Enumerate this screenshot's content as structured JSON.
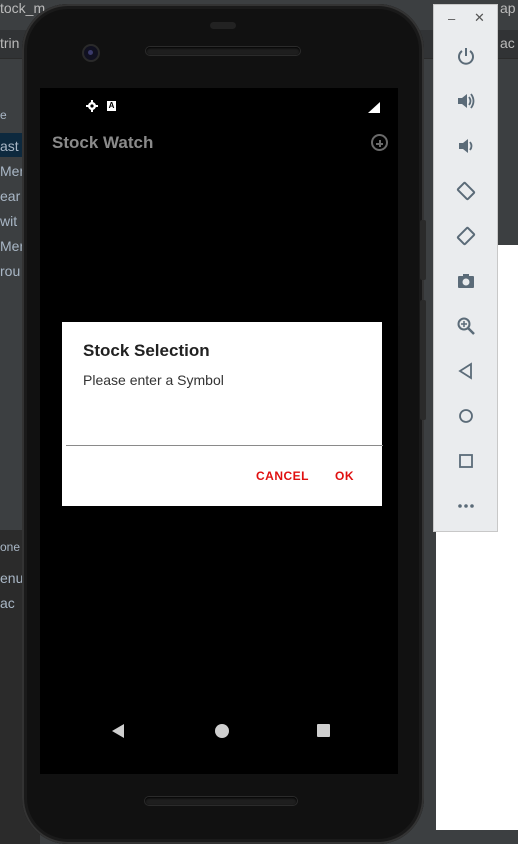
{
  "ide": {
    "top_left_text": "tock_m",
    "top_right_text": "ap",
    "row2_left_text": "trin",
    "row2_right_text": "ac",
    "left_panel_items": [
      "e",
      "ast",
      "Men",
      "ear",
      "wit",
      "Men",
      "rou"
    ],
    "bottom_items": [
      "one",
      "enu",
      "ac"
    ]
  },
  "phone": {
    "status": {
      "icons": [
        "gear-icon",
        "a-icon",
        "signal-icon"
      ]
    },
    "app_bar": {
      "title": "Stock Watch",
      "action_icon": "add-circle-icon"
    },
    "dialog": {
      "title": "Stock Selection",
      "message": "Please enter a Symbol",
      "input_value": "",
      "cancel_label": "CANCEL",
      "ok_label": "OK"
    },
    "nav": [
      "back-icon",
      "home-icon",
      "recents-icon"
    ]
  },
  "emulator_toolbar": {
    "minimize_label": "–",
    "close_label": "✕",
    "buttons": [
      "power-icon",
      "volume-up-icon",
      "volume-down-icon",
      "rotate-left-icon",
      "rotate-right-icon",
      "camera-icon",
      "zoom-icon",
      "back-icon",
      "home-icon",
      "overview-icon",
      "more-icon"
    ]
  },
  "colors": {
    "dialog_button": "#e01010",
    "app_title": "#8a8a8a",
    "ide_bg": "#3c3f41"
  }
}
